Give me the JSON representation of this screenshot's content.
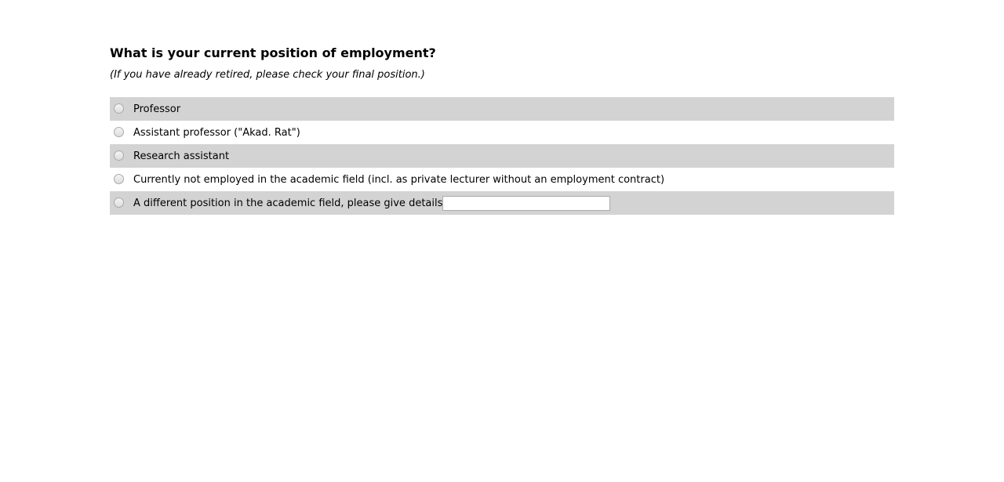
{
  "question": {
    "title": "What is your current position of employment?",
    "hint": "(If you have already retired, please check your final position.)"
  },
  "options": [
    {
      "label": "Professor"
    },
    {
      "label": "Assistant professor (\"Akad. Rat\")"
    },
    {
      "label": "Research assistant"
    },
    {
      "label": "Currently not employed in the academic field (incl. as private lecturer without an employment contract)"
    },
    {
      "label": "A different position in the academic field, please give details",
      "input_value": ""
    }
  ]
}
